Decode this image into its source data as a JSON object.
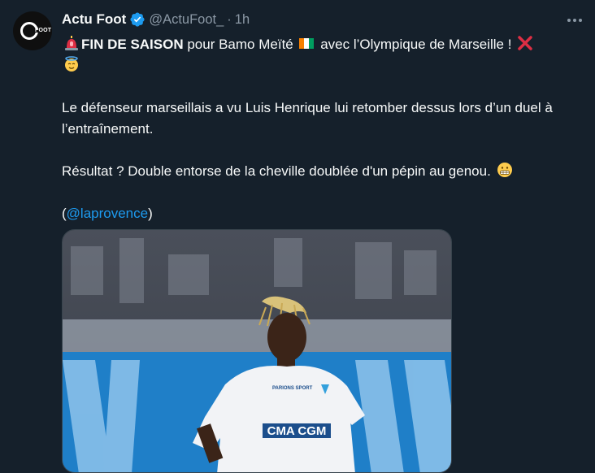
{
  "author": {
    "name": "Actu Foot",
    "handle": "@ActuFoot_",
    "separator": "·",
    "time": "1h",
    "avatar_text": "FOOT"
  },
  "tweet": {
    "line1_bold": "FIN DE SAISON",
    "line1_rest": " pour Bamo Meïté ",
    "line1_after_flag": " avec l’Olympique de Marseille ! ",
    "para2": "Le défenseur marseillais a vu Luis Henrique lui retomber dessus lors d’un duel à l’entraînement.",
    "para3": "Résultat ? Double entorse de la cheville doublée d'un pépin au genou. ",
    "mention_open": "(",
    "mention": "@laprovence",
    "mention_close": ")"
  },
  "media": {
    "jersey_sponsor": "CMA CGM",
    "jersey_badge": "PARIONS SPORT"
  },
  "colors": {
    "background": "#15202b",
    "text": "#f7f9f9",
    "secondary": "#8b98a5",
    "link": "#1d9bf0",
    "verified": "#1d9bf0"
  },
  "icons": [
    "siren-icon",
    "ivory-coast-flag-icon",
    "red-x-icon",
    "face-with-halo-icon",
    "grimacing-face-icon",
    "verified-badge-icon",
    "more-options-icon"
  ]
}
